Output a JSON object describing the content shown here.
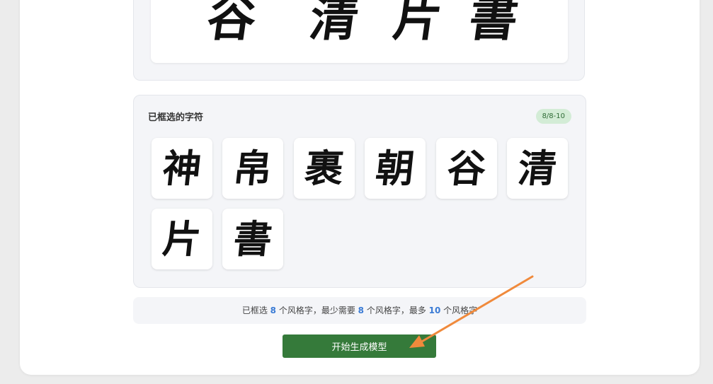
{
  "preview": {
    "glyphs": [
      "谷",
      "清",
      "片",
      "書"
    ]
  },
  "selected": {
    "title": "已框选的字符",
    "count_badge": "8/8-10",
    "chars": [
      "神",
      "帛",
      "裹",
      "朝",
      "谷",
      "清",
      "片",
      "書"
    ]
  },
  "info": {
    "prefix": "已框选 ",
    "selected_count": "8",
    "middle1": " 个风格字，最少需要 ",
    "min_count": "8",
    "middle2": " 个风格字，最多 ",
    "max_count": "10",
    "suffix": " 个风格字"
  },
  "action": {
    "generate_label": "开始生成模型"
  },
  "colors": {
    "accent_green": "#357a3a",
    "badge_green_bg": "#d3ecd6",
    "number_blue": "#3a7bd5",
    "annotation_arrow": "#f08a3c"
  }
}
